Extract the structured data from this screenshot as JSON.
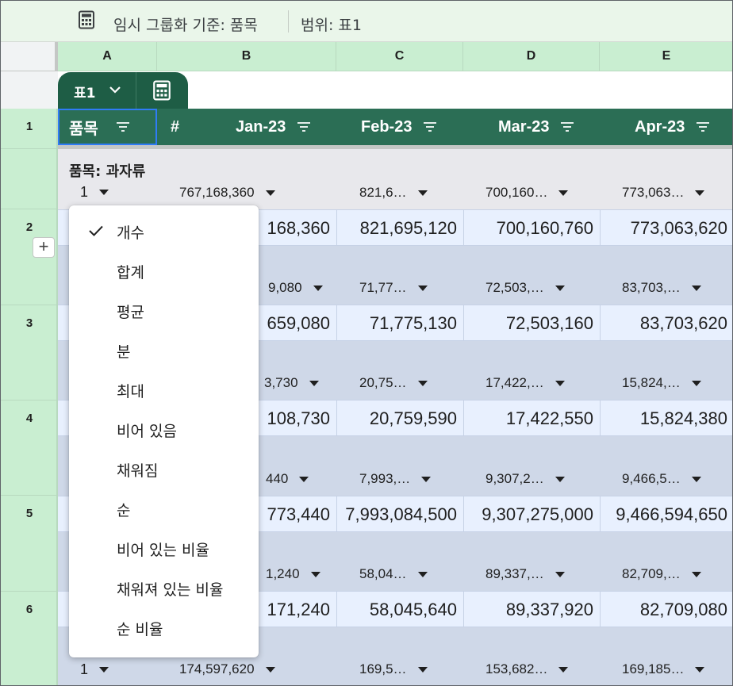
{
  "groupbar": {
    "label": "임시 그룹화 기준: 품목",
    "range": "범위:   표1"
  },
  "columns": [
    "A",
    "B",
    "C",
    "D",
    "E"
  ],
  "rows": [
    "1",
    "2",
    "3",
    "4",
    "5",
    "6"
  ],
  "table": {
    "name": "표1",
    "headers": {
      "item": "품목",
      "hash": "#",
      "c1": "Jan-23",
      "c2": "Feb-23",
      "c3": "Mar-23",
      "c4": "Apr-23"
    }
  },
  "groups": [
    {
      "title": "품목: 과자류",
      "count": "1",
      "sums": [
        "767,168,360",
        "821,6…",
        "700,160…",
        "773,063…"
      ],
      "values": [
        "168,360",
        "821,695,120",
        "700,160,760",
        "773,063,620"
      ]
    },
    {
      "title": "",
      "count": "",
      "sums": [
        "9,080",
        "71,77…",
        "72,503,…",
        "83,703,…"
      ],
      "values": [
        "659,080",
        "71,775,130",
        "72,503,160",
        "83,703,620"
      ]
    },
    {
      "title": "",
      "count": "",
      "sums": [
        "3,730",
        "20,75…",
        "17,422,…",
        "15,824,…"
      ],
      "values": [
        "108,730",
        "20,759,590",
        "17,422,550",
        "15,824,380"
      ]
    },
    {
      "title": "",
      "count": "",
      "sums": [
        "440",
        "7,993,…",
        "9,307,2…",
        "9,466,5…"
      ],
      "values": [
        "773,440",
        "7,993,084,500",
        "9,307,275,000",
        "9,466,594,650"
      ]
    },
    {
      "title": "",
      "count": "",
      "sums": [
        "1,240",
        "58,04…",
        "89,337,…",
        "82,709,…"
      ],
      "values": [
        "171,240",
        "58,045,640",
        "89,337,920",
        "82,709,080"
      ]
    },
    {
      "title": "",
      "count": "1",
      "sums": [
        "174,597,620",
        "169,5…",
        "153,682…",
        "169,185…"
      ],
      "values": []
    }
  ],
  "menu": {
    "items": [
      "개수",
      "합계",
      "평균",
      "분",
      "최대",
      "비어 있음",
      "채워짐",
      "순",
      "비어 있는 비율",
      "채워져 있는 비율",
      "순 비율"
    ],
    "checked_index": 0
  },
  "plus_label": "+"
}
